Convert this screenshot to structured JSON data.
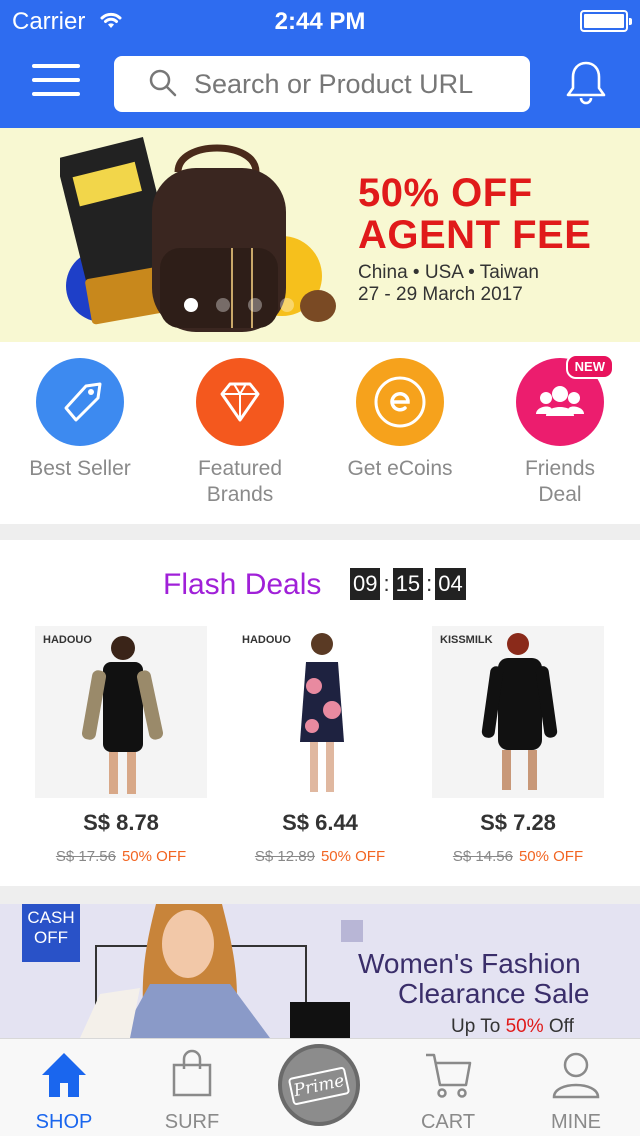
{
  "status_bar": {
    "carrier": "Carrier",
    "time": "2:44 PM"
  },
  "header": {
    "search_placeholder": "Search or Product URL",
    "accent_color": "#2e6cf0"
  },
  "promo_banner": {
    "title_line1": "50% OFF",
    "title_line2": "AGENT FEE",
    "subtitle_line1": "China • USA • Taiwan",
    "subtitle_line2": "27 - 29 March 2017",
    "carousel_dots": 4,
    "active_dot": 0
  },
  "categories": [
    {
      "label_line1": "Best Seller",
      "label_line2": "",
      "icon": "tag-icon",
      "color": "#3d8af0"
    },
    {
      "label_line1": "Featured",
      "label_line2": "Brands",
      "icon": "diamond-icon",
      "color": "#f4581e"
    },
    {
      "label_line1": "Get eCoins",
      "label_line2": "",
      "icon": "ecoin-icon",
      "color": "#f6a21c"
    },
    {
      "label_line1": "Friends",
      "label_line2": "Deal",
      "icon": "friends-icon",
      "color": "#ec1d6e",
      "badge": "NEW"
    }
  ],
  "flash_deals": {
    "title": "Flash Deals",
    "timer": {
      "hours": "09",
      "minutes": "15",
      "seconds": "04"
    },
    "products": [
      {
        "brand": "HADOUO",
        "price": "S$ 8.78",
        "old_price": "S$ 17.56",
        "discount": "50% OFF"
      },
      {
        "brand": "HADOUO",
        "price": "S$ 6.44",
        "old_price": "S$ 12.89",
        "discount": "50% OFF"
      },
      {
        "brand": "KISSMILK",
        "price": "S$ 7.28",
        "old_price": "S$ 14.56",
        "discount": "50% OFF"
      }
    ]
  },
  "womens_banner": {
    "badge_line1": "CASH",
    "badge_line2": "OFF",
    "title_line1": "Women's Fashion",
    "title_line2": "Clearance Sale",
    "sub_prefix": "Up To ",
    "sub_highlight": "50%",
    "sub_suffix": " Off"
  },
  "tabbar": {
    "tabs": [
      {
        "label": "SHOP",
        "icon": "home-icon",
        "active": true
      },
      {
        "label": "SURF",
        "icon": "shopping-bag-icon",
        "active": false
      },
      {
        "label": "",
        "icon": "prime-icon",
        "active": false
      },
      {
        "label": "CART",
        "icon": "cart-icon",
        "active": false
      },
      {
        "label": "MINE",
        "icon": "user-icon",
        "active": false
      }
    ],
    "prime_label": "Prime"
  }
}
